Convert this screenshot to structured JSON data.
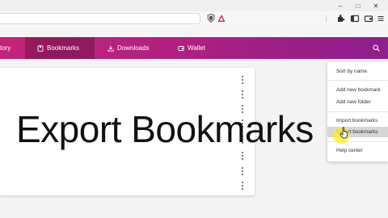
{
  "browser": {
    "window_controls": [
      "–",
      "□",
      "✕"
    ],
    "toolbar_icons": [
      "brave-shield-icon",
      "brave-rewards-icon",
      "extensions-icon",
      "sidebar-icon",
      "wallet-icon",
      "menu-icon"
    ]
  },
  "nav": {
    "tabs": [
      {
        "label": "tory",
        "icon": null,
        "active": false
      },
      {
        "label": "Bookmarks",
        "icon": "bookmark-icon",
        "active": true
      },
      {
        "label": "Downloads",
        "icon": "download-icon",
        "active": false
      },
      {
        "label": "Wallet",
        "icon": "wallet-icon",
        "active": false
      }
    ],
    "search_icon": "search-icon"
  },
  "bookmarks": {
    "row_menu_icon": "more-vertical-icon",
    "rows": 7
  },
  "dropdown": {
    "items": [
      {
        "label": "Sort by name",
        "highlighted": false
      },
      {
        "label": "Add new bookmark",
        "highlighted": false
      },
      {
        "label": "Add new folder",
        "highlighted": false
      },
      {
        "label": "Import bookmarks",
        "highlighted": false
      },
      {
        "label": "Export bookmarks",
        "highlighted": true
      },
      {
        "label": "Help center",
        "highlighted": false
      }
    ]
  },
  "overlay": {
    "caption": "Export Bookmarks"
  },
  "colors": {
    "nav_start": "#c2247b",
    "nav_end": "#8e1f8e",
    "highlight": "#d6d6d6",
    "click_glow": "#ffec28"
  }
}
